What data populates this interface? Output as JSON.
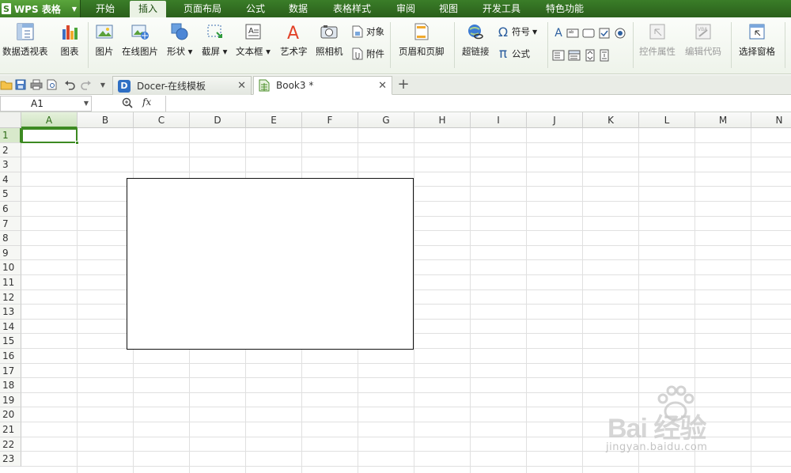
{
  "app": {
    "name": "WPS 表格",
    "logo_letter": "S"
  },
  "menu": {
    "items": [
      {
        "label": "开始"
      },
      {
        "label": "插入",
        "active": true
      },
      {
        "label": "页面布局"
      },
      {
        "label": "公式"
      },
      {
        "label": "数据"
      },
      {
        "label": "表格样式"
      },
      {
        "label": "审阅"
      },
      {
        "label": "视图"
      },
      {
        "label": "开发工具"
      },
      {
        "label": "特色功能"
      }
    ]
  },
  "ribbon": {
    "pivot_table": "数据透视表",
    "chart": "图表",
    "picture": "图片",
    "online_picture": "在线图片",
    "shapes": "形状",
    "screenshot": "截屏",
    "textbox": "文本框",
    "wordart": "艺术字",
    "camera": "照相机",
    "object": "对象",
    "attachment": "附件",
    "header_footer": "页眉和页脚",
    "hyperlink": "超链接",
    "symbol": "符号",
    "formula": "公式",
    "control_properties": "控件属性",
    "edit_code": "编辑代码",
    "selection_pane": "选择窗格",
    "symbol_glyph": "Ω",
    "formula_glyph": "π"
  },
  "tabs": {
    "docs": [
      {
        "label": "Docer-在线模板"
      },
      {
        "label": "Book3 *"
      }
    ],
    "new_tab": "+"
  },
  "formula_bar": {
    "name_box": "A1",
    "fx": "fx",
    "value": ""
  },
  "sheet": {
    "columns": [
      "A",
      "B",
      "C",
      "D",
      "E",
      "F",
      "G",
      "H",
      "I",
      "J",
      "K",
      "L",
      "M",
      "N"
    ],
    "rows": [
      "1",
      "2",
      "3",
      "4",
      "5",
      "6",
      "7",
      "8",
      "9",
      "10",
      "11",
      "12",
      "13",
      "14",
      "15",
      "16",
      "17",
      "18",
      "19",
      "20",
      "21",
      "22",
      "23"
    ],
    "selected_cell": "A1"
  },
  "watermark": {
    "brand": "Bai 经验",
    "url": "jingyan.baidu.com"
  },
  "colors": {
    "accent_green": "#3d8a22",
    "title_bar": "#2f6b1f"
  }
}
